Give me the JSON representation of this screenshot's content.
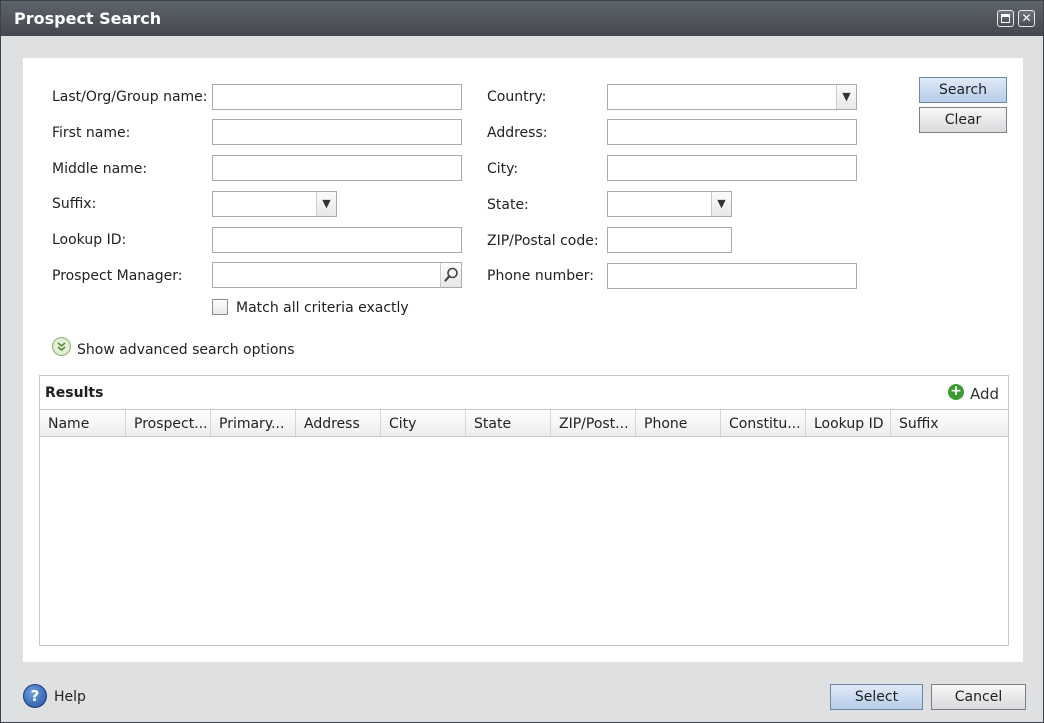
{
  "window": {
    "title": "Prospect Search"
  },
  "form": {
    "left": {
      "last_name_label": "Last/Org/Group name:",
      "first_name_label": "First name:",
      "middle_name_label": "Middle name:",
      "suffix_label": "Suffix:",
      "lookup_id_label": "Lookup ID:",
      "prospect_manager_label": "Prospect Manager:",
      "match_all_label": "Match all criteria exactly"
    },
    "right": {
      "country_label": "Country:",
      "address_label": "Address:",
      "city_label": "City:",
      "state_label": "State:",
      "zip_label": "ZIP/Postal code:",
      "phone_label": "Phone number:"
    },
    "values": {
      "last_name": "",
      "first_name": "",
      "middle_name": "",
      "suffix": "",
      "lookup_id": "",
      "prospect_manager": "",
      "country": "",
      "address": "",
      "city": "",
      "state": "",
      "zip": "",
      "phone": ""
    },
    "match_all_checked": false
  },
  "actions": {
    "search_label": "Search",
    "clear_label": "Clear"
  },
  "advanced": {
    "label": "Show advanced search options"
  },
  "results": {
    "title": "Results",
    "add_label": "Add",
    "columns": [
      "Name",
      "Prospect...",
      "Primary...",
      "Address",
      "City",
      "State",
      "ZIP/Post...",
      "Phone",
      "Constitu...",
      "Lookup ID",
      "Suffix"
    ],
    "rows": []
  },
  "footer": {
    "help_label": "Help",
    "select_label": "Select",
    "cancel_label": "Cancel"
  },
  "icons": {
    "dropdown": "chevron-down-icon",
    "lookup": "magnifier-icon",
    "help": "question-icon",
    "add": "plus-circle-icon",
    "expand": "double-chevron-down-icon"
  },
  "colors": {
    "titlebar": "#4f555b",
    "primary_button": "#c9dbf0",
    "add_icon": "#3d9a35",
    "help_icon": "#2c63b8"
  }
}
